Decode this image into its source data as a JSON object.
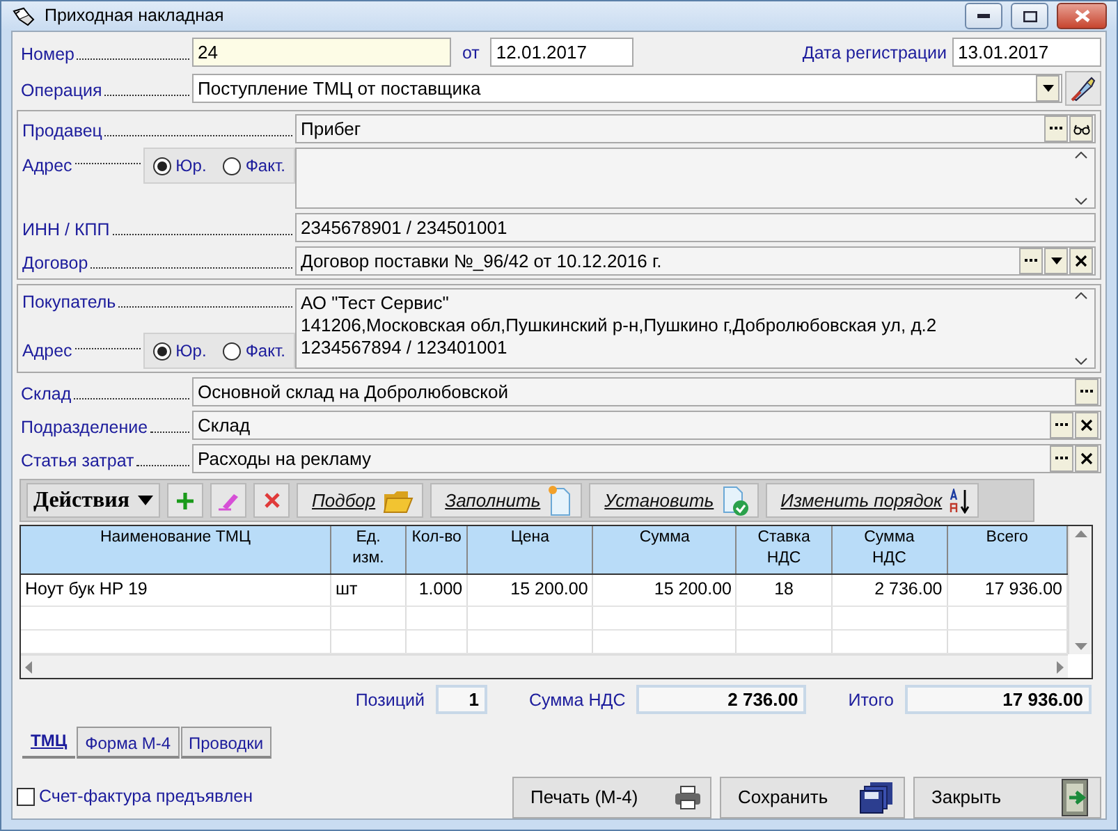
{
  "window": {
    "title": "Приходная накладная"
  },
  "header": {
    "number": {
      "label": "Номер",
      "value": "24"
    },
    "date": {
      "label": "от",
      "value": "12.01.2017"
    },
    "registration_date": {
      "label": "Дата регистрации",
      "value": "13.01.2017"
    },
    "operation": {
      "label": "Операция",
      "value": "Поступление ТМЦ от поставщика",
      "buttons": [
        {
          "kind": "dropdown"
        }
      ]
    }
  },
  "seller": {
    "label": "Продавец",
    "value": "Прибег",
    "buttons": [
      {
        "kind": "browse"
      },
      {
        "kind": "view"
      }
    ],
    "address": {
      "label": "Адрес",
      "options": [
        {
          "label": "Юр.",
          "selected": true
        },
        {
          "label": "Факт.",
          "selected": false
        }
      ]
    },
    "inn_kpp": {
      "label": "ИНН / КПП",
      "value": "2345678901 / 234501001"
    },
    "contract": {
      "label": "Договор",
      "value": "Договор поставки №_96/42 от 10.12.2016 г.",
      "buttons": [
        {
          "kind": "browse"
        },
        {
          "kind": "dropdown"
        },
        {
          "kind": "clear"
        }
      ]
    }
  },
  "buyer": {
    "label": "Покупатель",
    "value": "АО \"Тест Сервис\"\n141206,Московская обл,Пушкинский р-н,Пушкино г,Добролюбовская ул, д.2\n1234567894 / 123401001",
    "address": {
      "label": "Адрес",
      "options": [
        {
          "label": "Юр.",
          "selected": true
        },
        {
          "label": "Факт.",
          "selected": false
        }
      ]
    }
  },
  "fields": [
    {
      "label": "Склад",
      "value": "Основной склад на Добролюбовской",
      "buttons": [
        {
          "kind": "browse"
        }
      ]
    },
    {
      "label": "Подразделение",
      "value": "Склад",
      "buttons": [
        {
          "kind": "browse"
        },
        {
          "kind": "clear"
        }
      ]
    },
    {
      "label": "Статья затрат",
      "value": "Расходы на рекламу",
      "buttons": [
        {
          "kind": "browse"
        },
        {
          "kind": "clear"
        }
      ]
    }
  ],
  "toolbar": {
    "actions": "Действия",
    "buttons": [
      {
        "kind": "add"
      },
      {
        "kind": "edit"
      },
      {
        "kind": "delete"
      },
      {
        "kind": "pick",
        "label": "Подбор"
      },
      {
        "kind": "fill",
        "label": "Заполнить"
      },
      {
        "kind": "set",
        "label": "Установить"
      },
      {
        "kind": "sort",
        "label": "Изменить порядок"
      }
    ]
  },
  "table": {
    "columns": [
      "Наименование ТМЦ",
      "Ед.\nизм.",
      "Кол-во",
      "Цена",
      "Сумма",
      "Ставка\nНДС",
      "Сумма\nНДС",
      "Всего"
    ],
    "rows": [
      [
        "Ноут бук HP 19",
        "шт",
        "1.000",
        "15 200.00",
        "15 200.00",
        "18",
        "2 736.00",
        "17 936.00"
      ]
    ]
  },
  "totals": [
    {
      "label": "Позиций",
      "value": "1"
    },
    {
      "label": "Сумма НДС",
      "value": "2 736.00"
    },
    {
      "label": "Итого",
      "value": "17 936.00"
    }
  ],
  "tabs": [
    {
      "label": "ТМЦ",
      "selected": true
    },
    {
      "label": "Форма М-4",
      "selected": false
    },
    {
      "label": "Проводки",
      "selected": false
    }
  ],
  "invoice_checkbox": {
    "label": "Счет-фактура предъявлен",
    "checked": false
  },
  "buttons": [
    {
      "kind": "print",
      "label": "Печать (М-4)"
    },
    {
      "kind": "save",
      "label": "Сохранить"
    },
    {
      "kind": "close",
      "label": "Закрыть"
    }
  ]
}
